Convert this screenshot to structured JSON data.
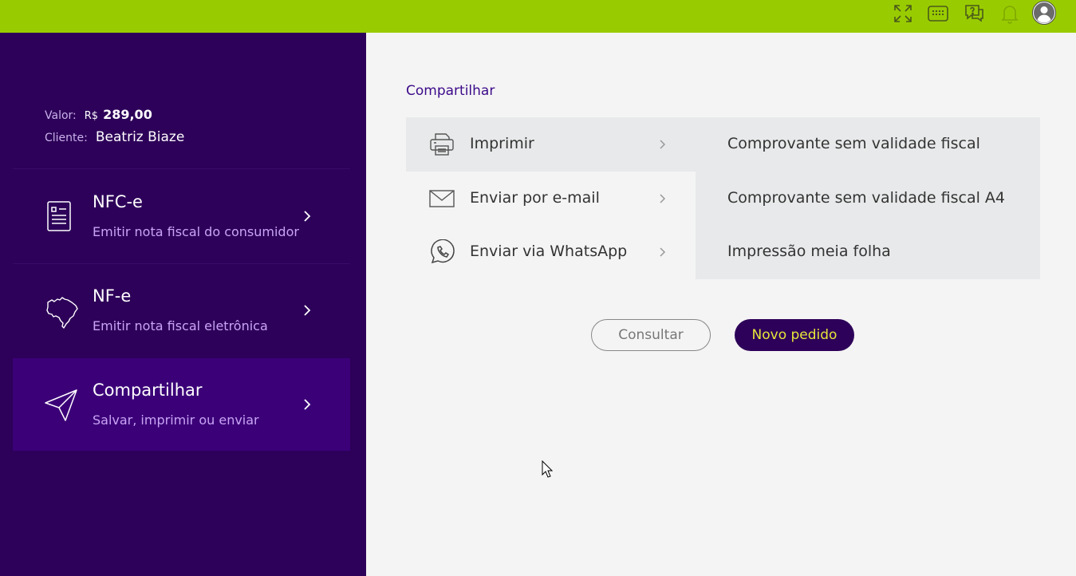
{
  "topbar": {
    "color": "#99cc00",
    "icons": [
      "fullscreen-icon",
      "keyboard-icon",
      "help-chat-icon",
      "bell-icon",
      "user-avatar-icon"
    ]
  },
  "sidebar": {
    "info": {
      "value_label": "Valor:",
      "currency": "R$",
      "value": "289,00",
      "client_label": "Cliente:",
      "client": "Beatriz Biaze"
    },
    "items": [
      {
        "title": "NFC-e",
        "subtitle": "Emitir nota fiscal do consumidor",
        "icon": "receipt-icon"
      },
      {
        "title": "NF-e",
        "subtitle": "Emitir nota fiscal eletrônica",
        "icon": "brazil-map-icon"
      },
      {
        "title": "Compartilhar",
        "subtitle": "Salvar, imprimir ou enviar",
        "icon": "send-icon",
        "active": true
      }
    ]
  },
  "main": {
    "title": "Compartilhar",
    "options": [
      {
        "label": "Imprimir",
        "icon": "printer-icon",
        "selected": true
      },
      {
        "label": "Enviar por e-mail",
        "icon": "mail-icon"
      },
      {
        "label": "Enviar via WhatsApp",
        "icon": "whatsapp-icon"
      }
    ],
    "print_options": [
      "Comprovante sem validade fiscal",
      "Comprovante sem validade fiscal A4",
      "Impressão meia folha"
    ],
    "buttons": {
      "consultar": "Consultar",
      "novo_pedido": "Novo pedido"
    }
  },
  "colors": {
    "sidebar_bg": "#2d0059",
    "sidebar_active": "#3b0078",
    "accent_yellow": "#e6e63a",
    "topbar_green": "#99cc00"
  }
}
